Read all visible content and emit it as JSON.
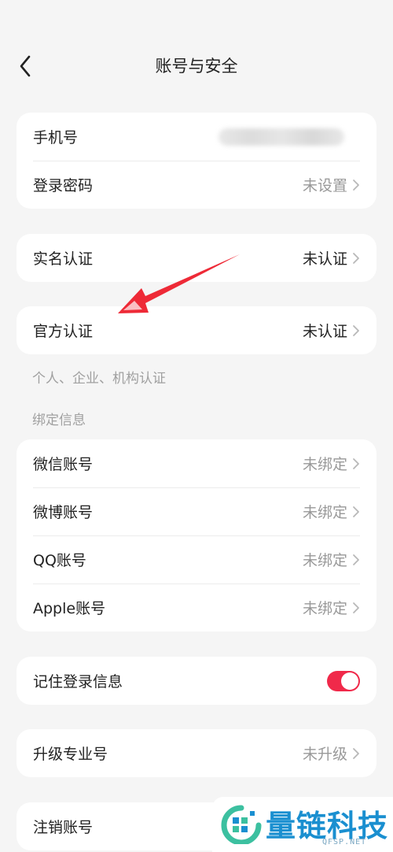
{
  "header": {
    "title": "账号与安全"
  },
  "account": {
    "phone_label": "手机号",
    "password_label": "登录密码",
    "password_value": "未设置"
  },
  "realname": {
    "label": "实名认证",
    "value": "未认证"
  },
  "official": {
    "label": "官方认证",
    "value": "未认证",
    "note": "个人、企业、机构认证"
  },
  "bindings": {
    "section_title": "绑定信息",
    "items": [
      {
        "label": "微信账号",
        "value": "未绑定"
      },
      {
        "label": "微博账号",
        "value": "未绑定"
      },
      {
        "label": "QQ账号",
        "value": "未绑定"
      },
      {
        "label": "Apple账号",
        "value": "未绑定"
      }
    ]
  },
  "remember": {
    "label": "记住登录信息",
    "enabled": true
  },
  "upgrade": {
    "label": "升级专业号",
    "value": "未升级"
  },
  "cancel": {
    "label": "注销账号"
  },
  "watermark": {
    "brand": "量链科技",
    "domain": "QFSP.NET"
  },
  "colors": {
    "accent": "#f0294a",
    "background": "#f5f5f5",
    "watermark": "#1a8fd0"
  }
}
